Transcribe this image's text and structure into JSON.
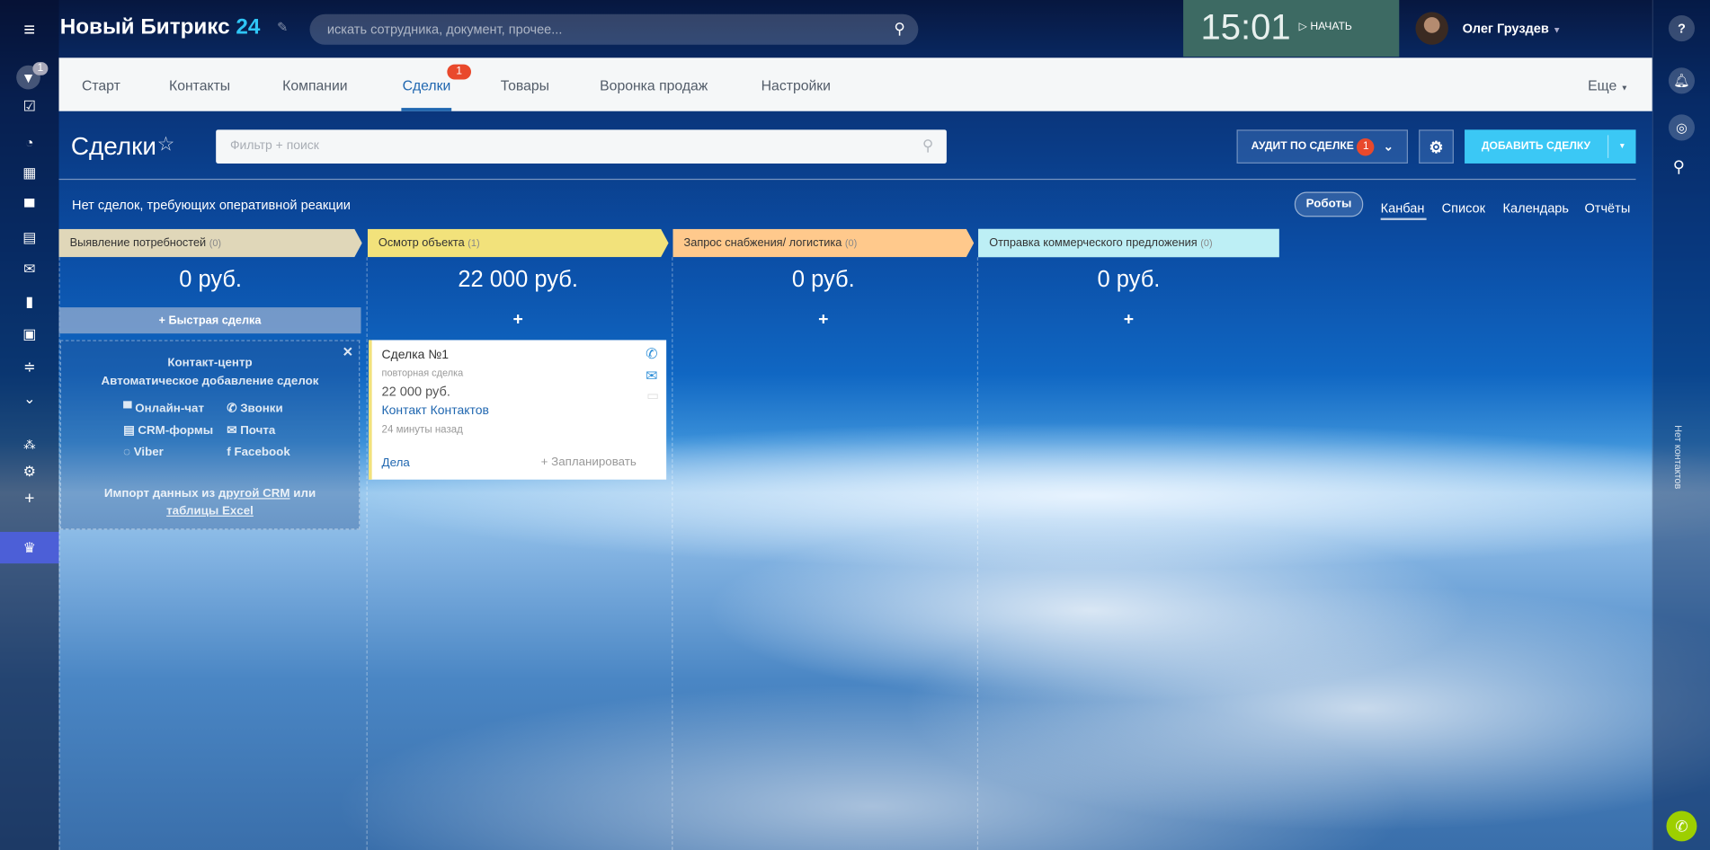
{
  "header": {
    "title_main": "Новый Битрикс",
    "title_num": "24",
    "search_placeholder": "искать сотрудника, документ, прочее...",
    "clock": "15:01",
    "start_label": "НАЧАТЬ",
    "user_name": "Олег Груздев"
  },
  "sidebar": {
    "filter_badge": "1"
  },
  "nav": {
    "items": [
      "Старт",
      "Контакты",
      "Компании",
      "Сделки",
      "Товары",
      "Воронка продаж",
      "Настройки"
    ],
    "active": "Сделки",
    "deals_badge": "1",
    "more": "Еще"
  },
  "toolbar": {
    "page_title": "Сделки",
    "filter_placeholder": "Фильтр + поиск",
    "audit_label": "АУДИТ ПО СДЕЛКЕ",
    "audit_badge": "1",
    "add_label": "ДОБАВИТЬ СДЕЛКУ"
  },
  "subbar": {
    "notice": "Нет сделок, требующих оперативной реакции",
    "robots": "Роботы",
    "views": [
      "Канбан",
      "Список",
      "Календарь",
      "Отчёты"
    ],
    "active_view": "Канбан"
  },
  "stages": [
    {
      "name": "Выявление потребностей",
      "count": "(0)",
      "sum": "0 руб.",
      "color": "#e0d7b9"
    },
    {
      "name": "Осмотр объекта",
      "count": "(1)",
      "sum": "22 000 руб.",
      "color": "#f2e27b"
    },
    {
      "name": "Запрос снабжения/ логистика",
      "count": "(0)",
      "sum": "0 руб.",
      "color": "#ffc98c"
    },
    {
      "name": "Отправка коммерческого предложения",
      "count": "(0)",
      "sum": "0 руб.",
      "color": "#bdeff5"
    }
  ],
  "quick_deal": "Быстрая сделка",
  "contact_center": {
    "title": "Контакт-центр",
    "subtitle": "Автоматическое добавление сделок",
    "channels": [
      "Онлайн-чат",
      "Звонки",
      "CRM-формы",
      "Почта",
      "Viber",
      "Facebook"
    ],
    "import_prefix": "Импорт данных из",
    "import_link1": "другой CRM",
    "import_mid": "или",
    "import_link2": "таблицы Excel"
  },
  "deal_card": {
    "title": "Сделка №1",
    "type": "повторная сделка",
    "amount": "22 000 руб.",
    "contact": "Контакт Контактов",
    "time": "24 минуты назад",
    "activities": "Дела",
    "plan": "+ Запланировать"
  },
  "right_panel": {
    "no_contacts": "Нет контактов"
  }
}
